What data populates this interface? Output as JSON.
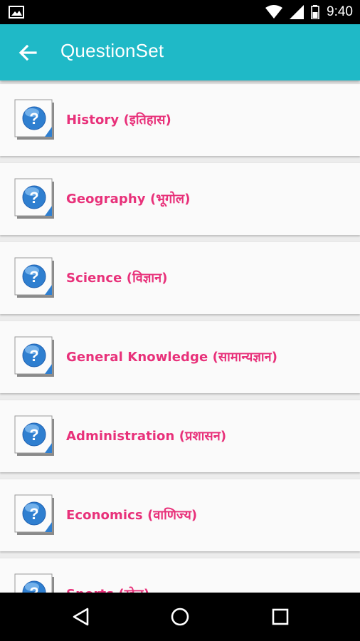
{
  "status_bar": {
    "time": "9:40",
    "icons": [
      "image-notification-icon",
      "wifi-icon",
      "cell-signal-icon",
      "battery-icon"
    ]
  },
  "app_bar": {
    "title": "QuestionSet",
    "back_icon": "arrow-left-icon",
    "color": "#1fb9c7"
  },
  "question_sets": [
    {
      "label": "History (इतिहास)"
    },
    {
      "label": "Geography (भूगोल)"
    },
    {
      "label": "Science (विज्ञान)"
    },
    {
      "label": "General Knowledge (सामान्यज्ञान)"
    },
    {
      "label": "Administration (प्रशासन)"
    },
    {
      "label": "Economics (वाणिज्य)"
    },
    {
      "label": "Sports (खेल)"
    }
  ],
  "label_color": "#e8317a",
  "nav_bar": {
    "buttons": [
      "back-triangle-icon",
      "home-circle-icon",
      "recents-square-icon"
    ]
  }
}
